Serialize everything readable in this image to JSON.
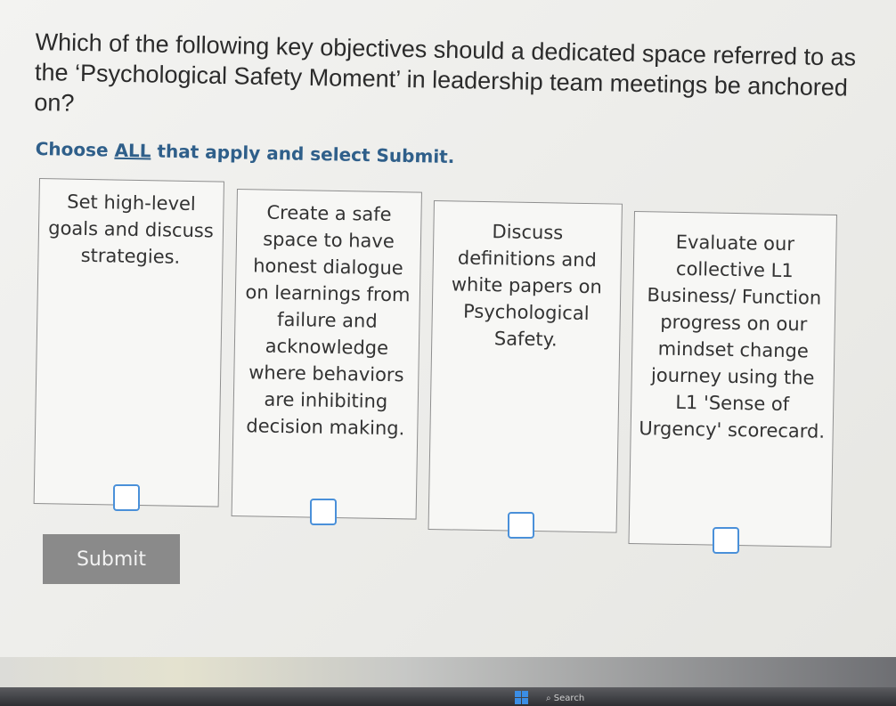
{
  "question": {
    "text": "Which of the following key objectives should a dedicated space referred to as the ‘Psychological Safety Moment’ in leadership team meetings be anchored on?"
  },
  "instruction": {
    "prefix": "Choose ",
    "emphasis": "ALL",
    "suffix": " that apply and select Submit."
  },
  "options": [
    {
      "text": "Set high-level goals and discuss strategies.",
      "checked": false
    },
    {
      "text": "Create a safe space to have honest dialogue on learnings from failure and acknowledge where behaviors are inhibiting decision making.",
      "checked": false
    },
    {
      "text": "Discuss definitions and white papers on Psychological Safety.",
      "checked": false
    },
    {
      "text": "Evaluate our collective L1 Business/ Function progress on our mindset change journey using the L1 'Sense of Urgency' scorecard.",
      "checked": false
    }
  ],
  "submit": {
    "label": "Submit"
  },
  "taskbar": {
    "search_label": "Search"
  },
  "colors": {
    "checkbox_border": "#4a90d9",
    "instruction": "#2f5f8a",
    "submit_bg": "#8a8a8a"
  }
}
